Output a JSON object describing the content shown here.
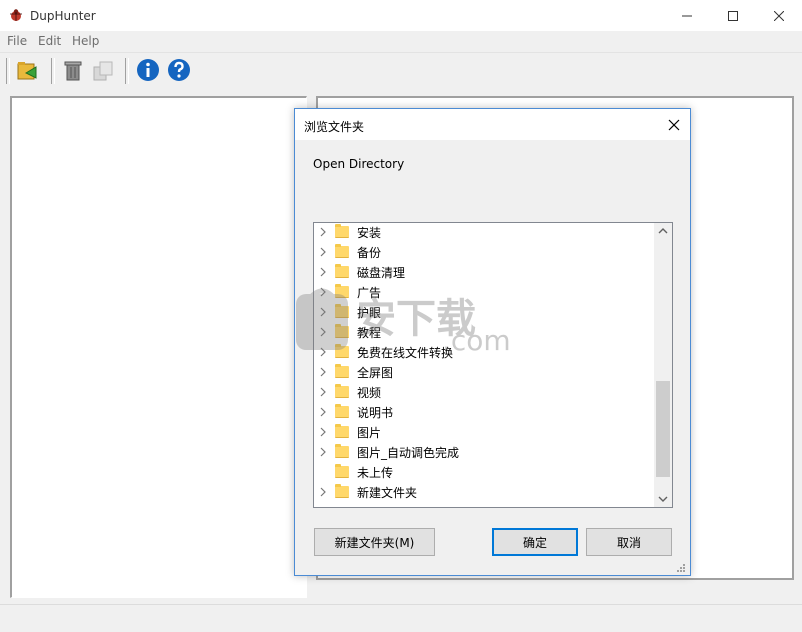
{
  "app": {
    "title": "DupHunter"
  },
  "menu": {
    "file": "File",
    "edit": "Edit",
    "help": "Help"
  },
  "dialog": {
    "title": "浏览文件夹",
    "description": "Open Directory",
    "folders": [
      "安装",
      "备份",
      "磁盘清理",
      "广告",
      "护眼",
      "教程",
      "免费在线文件转换",
      "全屏图",
      "视频",
      "说明书",
      "图片",
      "图片_自动调色完成",
      "未上传",
      "新建文件夹"
    ],
    "expandable": [
      true,
      true,
      true,
      true,
      true,
      true,
      true,
      true,
      true,
      true,
      true,
      true,
      false,
      true
    ],
    "buttons": {
      "new_folder": "新建文件夹(M)",
      "ok": "确定",
      "cancel": "取消"
    }
  },
  "watermark": {
    "text": "安下载",
    "domain": ".com"
  },
  "colors": {
    "dialog_border": "#4b8bd4",
    "ok_border": "#0078d7",
    "folder": "#ffd86b"
  }
}
